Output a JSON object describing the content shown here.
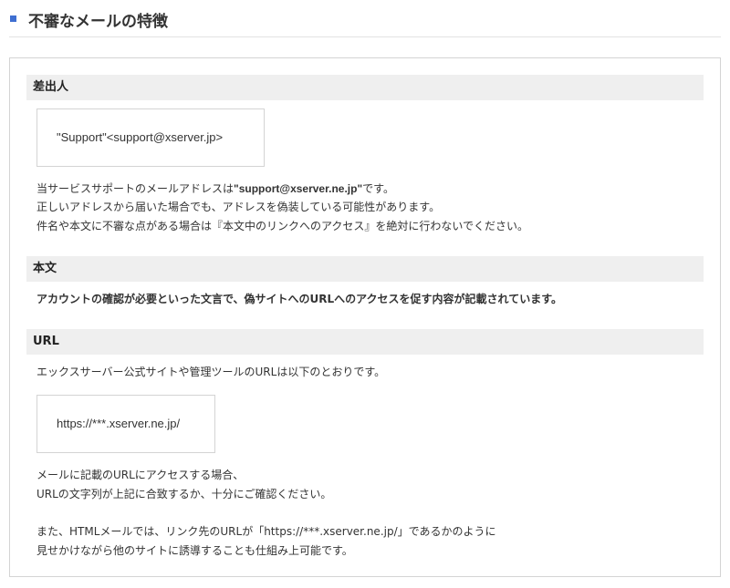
{
  "header": {
    "title": "不審なメールの特徴"
  },
  "sections": {
    "sender": {
      "heading": "差出人",
      "address_example": "\"Support\"<support@xserver.jp>",
      "para1_before": "当サービスサポートのメールアドレスは",
      "para1_bold": "\"support@xserver.ne.jp\"",
      "para1_after": "です。",
      "para2": "正しいアドレスから届いた場合でも、アドレスを偽装している可能性があります。",
      "para3": "件名や本文に不審な点がある場合は『本文中のリンクへのアクセス』を絶対に行わないでください。"
    },
    "body": {
      "heading": "本文",
      "text": "アカウントの確認が必要といった文言で、偽サイトへのURLへのアクセスを促す内容が記載されています。"
    },
    "url": {
      "heading": "URL",
      "intro": "エックスサーバー公式サイトや管理ツールのURLは以下のとおりです。",
      "url_example": "https://***.xserver.ne.jp/",
      "note1": "メールに記載のURLにアクセスする場合、",
      "note2": "URLの文字列が上記に合致するか、十分にご確認ください。",
      "note3": "また、HTMLメールでは、リンク先のURLが「https://***.xserver.ne.jp/」であるかのように",
      "note4": "見せかけながら他のサイトに誘導することも仕組み上可能です。"
    }
  },
  "colors": {
    "accent": "#3f6fd1",
    "section_bg": "#efefef",
    "border": "#d4d4d4"
  }
}
